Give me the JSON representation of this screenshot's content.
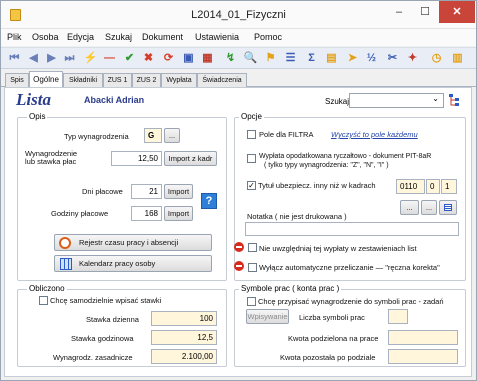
{
  "window": {
    "title": "L2014_01_Fizyczni",
    "min": "–",
    "max": "☐",
    "close": "✕"
  },
  "menu": [
    "Plik",
    "Osoba",
    "Edycja",
    "Szukaj",
    "Dokument",
    "Ustawienia",
    "Pomoc"
  ],
  "toolbar_icons": [
    {
      "name": "first-record-icon",
      "glyph": "⏮",
      "color": "#6a7fb8"
    },
    {
      "name": "prev-record-icon",
      "glyph": "◀",
      "color": "#6a7fb8"
    },
    {
      "name": "next-record-icon",
      "glyph": "▶",
      "color": "#6a7fb8"
    },
    {
      "name": "last-record-icon",
      "glyph": "⏭",
      "color": "#6a7fb8"
    },
    {
      "name": "edit-icon",
      "glyph": "⚡",
      "color": "#3c63c9"
    },
    {
      "name": "delete-icon",
      "glyph": "—",
      "color": "#d63e2a"
    },
    {
      "name": "confirm-icon",
      "glyph": "✔",
      "color": "#2d9a2d"
    },
    {
      "name": "cancel-icon",
      "glyph": "✖",
      "color": "#d63e2a"
    },
    {
      "name": "refresh-icon",
      "glyph": "⟳",
      "color": "#d63e2a"
    },
    {
      "name": "save-icon",
      "glyph": "▣",
      "color": "#3b5bb5"
    },
    {
      "name": "table-icon",
      "glyph": "▦",
      "color": "#c0392b"
    },
    {
      "name": "green-arrow-icon",
      "glyph": "↯",
      "color": "#2d9a2d"
    },
    {
      "name": "search-icon",
      "glyph": "🔍",
      "color": "#3b5bb5"
    },
    {
      "name": "filter-icon",
      "glyph": "⚑",
      "color": "#e4a21b"
    },
    {
      "name": "list-icon",
      "glyph": "☰",
      "color": "#3b5bb5"
    },
    {
      "name": "sum-icon",
      "glyph": "Σ",
      "color": "#3b5bb5"
    },
    {
      "name": "report-icon",
      "glyph": "▤",
      "color": "#e4a21b"
    },
    {
      "name": "tag-icon",
      "glyph": "➤",
      "color": "#e4a21b"
    },
    {
      "name": "fraction-icon",
      "glyph": "½",
      "color": "#3b5bb5"
    },
    {
      "name": "tools-icon",
      "glyph": "✂",
      "color": "#3b5bb5"
    },
    {
      "name": "magic-icon",
      "glyph": "✦",
      "color": "#c0392b"
    },
    {
      "name": "clock-icon",
      "glyph": "◷",
      "color": "#e4a21b"
    },
    {
      "name": "exit-icon",
      "glyph": "▥",
      "color": "#e4a21b"
    }
  ],
  "tabs": [
    "Spis",
    "Ogólne",
    "Składniki",
    "ZUS 1",
    "ZUS 2",
    "Wypłata",
    "Świadczenia"
  ],
  "header": {
    "lista": "Lista",
    "person": "Abacki Adrian",
    "search_label": "Szukaj",
    "search_value": ""
  },
  "opis": {
    "title": "Opis",
    "typ_label": "Typ wynagrodzenia",
    "typ_value": "G",
    "typ_btn": "...",
    "wyn_label_1": "Wynagrodzenie",
    "wyn_label_2": "lub stawka płac",
    "wyn_value": "12,50",
    "import_kadr": "Import z kadr",
    "dni_label": "Dni płacowe",
    "dni_value": "21",
    "godz_label": "Godziny płacowe",
    "godz_value": "168",
    "import": "Import",
    "help": "?",
    "rejestr": "Rejestr czasu pracy i absencji",
    "kalendarz": "Kalendarz pracy osoby"
  },
  "opcje": {
    "title": "Opcje",
    "filtra": "Pole dla FILTRA",
    "wyczysc": "Wyczyść to pole każdemu",
    "ryczalt_1": "Wypłata opodatkowana ryczałtowo - dokument  PIT-8aR",
    "ryczalt_2": "( tylko typy wynagrodzenia:  \"Z\",  \"N\",  \"I\" )",
    "tytul": "Tytuł ubezpiecz. inny niż w kadrach",
    "tytul_checked": true,
    "code_1": "0110",
    "code_2": "0",
    "code_3": "1",
    "dots": "...",
    "notatka": "Notatka  ( nie jest drukowana )",
    "notatka_value": "",
    "nie_uwzgl": "Nie uwzględniaj tej wypłaty w zestawieniach list",
    "wylacz": "Wyłącz automatyczne przeliczanie  — \"ręczna korekta\""
  },
  "obliczono": {
    "title": "Obliczono",
    "samodzielnie": "Chcę samodzielnie wpisać stawki",
    "stawka_dzienna_label": "Stawka dzienna",
    "stawka_dzienna": "100",
    "stawka_godz_label": "Stawka godzinowa",
    "stawka_godz": "12,5",
    "wyn_zasad_label": "Wynagrodz. zasadnicze",
    "wyn_zasad": "2.100,00"
  },
  "symbole": {
    "title": "Symbole prac ( konta prac )",
    "chce": "Chcę przypisać wynagrodzenie do symboli prac - zadań",
    "wpisywanie": "Wpisywanie",
    "liczba_label": "Liczba symboli prac",
    "liczba_value": "",
    "kwota_podz_label": "Kwota podzielona na prace",
    "kwota_podz": "",
    "kwota_poz_label": "Kwota pozostała po podziale",
    "kwota_poz": ""
  },
  "colors": {
    "accent": "#2a3c8c",
    "close": "#c9453a",
    "input_yellow": "#fff6dc"
  }
}
